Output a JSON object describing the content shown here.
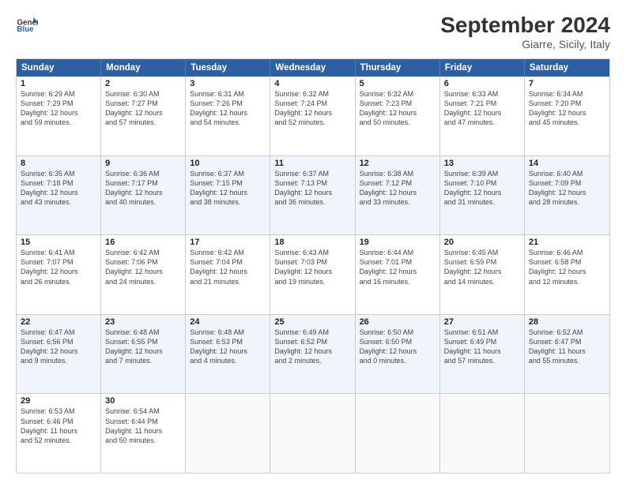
{
  "header": {
    "logo_line1": "General",
    "logo_line2": "Blue",
    "month_year": "September 2024",
    "location": "Giarre, Sicily, Italy"
  },
  "days_of_week": [
    "Sunday",
    "Monday",
    "Tuesday",
    "Wednesday",
    "Thursday",
    "Friday",
    "Saturday"
  ],
  "rows": [
    {
      "alt": false,
      "cells": [
        {
          "day": "1",
          "lines": [
            "Sunrise: 6:29 AM",
            "Sunset: 7:29 PM",
            "Daylight: 12 hours",
            "and 59 minutes."
          ]
        },
        {
          "day": "2",
          "lines": [
            "Sunrise: 6:30 AM",
            "Sunset: 7:27 PM",
            "Daylight: 12 hours",
            "and 57 minutes."
          ]
        },
        {
          "day": "3",
          "lines": [
            "Sunrise: 6:31 AM",
            "Sunset: 7:26 PM",
            "Daylight: 12 hours",
            "and 54 minutes."
          ]
        },
        {
          "day": "4",
          "lines": [
            "Sunrise: 6:32 AM",
            "Sunset: 7:24 PM",
            "Daylight: 12 hours",
            "and 52 minutes."
          ]
        },
        {
          "day": "5",
          "lines": [
            "Sunrise: 6:32 AM",
            "Sunset: 7:23 PM",
            "Daylight: 12 hours",
            "and 50 minutes."
          ]
        },
        {
          "day": "6",
          "lines": [
            "Sunrise: 6:33 AM",
            "Sunset: 7:21 PM",
            "Daylight: 12 hours",
            "and 47 minutes."
          ]
        },
        {
          "day": "7",
          "lines": [
            "Sunrise: 6:34 AM",
            "Sunset: 7:20 PM",
            "Daylight: 12 hours",
            "and 45 minutes."
          ]
        }
      ]
    },
    {
      "alt": true,
      "cells": [
        {
          "day": "8",
          "lines": [
            "Sunrise: 6:35 AM",
            "Sunset: 7:18 PM",
            "Daylight: 12 hours",
            "and 43 minutes."
          ]
        },
        {
          "day": "9",
          "lines": [
            "Sunrise: 6:36 AM",
            "Sunset: 7:17 PM",
            "Daylight: 12 hours",
            "and 40 minutes."
          ]
        },
        {
          "day": "10",
          "lines": [
            "Sunrise: 6:37 AM",
            "Sunset: 7:15 PM",
            "Daylight: 12 hours",
            "and 38 minutes."
          ]
        },
        {
          "day": "11",
          "lines": [
            "Sunrise: 6:37 AM",
            "Sunset: 7:13 PM",
            "Daylight: 12 hours",
            "and 36 minutes."
          ]
        },
        {
          "day": "12",
          "lines": [
            "Sunrise: 6:38 AM",
            "Sunset: 7:12 PM",
            "Daylight: 12 hours",
            "and 33 minutes."
          ]
        },
        {
          "day": "13",
          "lines": [
            "Sunrise: 6:39 AM",
            "Sunset: 7:10 PM",
            "Daylight: 12 hours",
            "and 31 minutes."
          ]
        },
        {
          "day": "14",
          "lines": [
            "Sunrise: 6:40 AM",
            "Sunset: 7:09 PM",
            "Daylight: 12 hours",
            "and 28 minutes."
          ]
        }
      ]
    },
    {
      "alt": false,
      "cells": [
        {
          "day": "15",
          "lines": [
            "Sunrise: 6:41 AM",
            "Sunset: 7:07 PM",
            "Daylight: 12 hours",
            "and 26 minutes."
          ]
        },
        {
          "day": "16",
          "lines": [
            "Sunrise: 6:42 AM",
            "Sunset: 7:06 PM",
            "Daylight: 12 hours",
            "and 24 minutes."
          ]
        },
        {
          "day": "17",
          "lines": [
            "Sunrise: 6:42 AM",
            "Sunset: 7:04 PM",
            "Daylight: 12 hours",
            "and 21 minutes."
          ]
        },
        {
          "day": "18",
          "lines": [
            "Sunrise: 6:43 AM",
            "Sunset: 7:03 PM",
            "Daylight: 12 hours",
            "and 19 minutes."
          ]
        },
        {
          "day": "19",
          "lines": [
            "Sunrise: 6:44 AM",
            "Sunset: 7:01 PM",
            "Daylight: 12 hours",
            "and 16 minutes."
          ]
        },
        {
          "day": "20",
          "lines": [
            "Sunrise: 6:45 AM",
            "Sunset: 6:59 PM",
            "Daylight: 12 hours",
            "and 14 minutes."
          ]
        },
        {
          "day": "21",
          "lines": [
            "Sunrise: 6:46 AM",
            "Sunset: 6:58 PM",
            "Daylight: 12 hours",
            "and 12 minutes."
          ]
        }
      ]
    },
    {
      "alt": true,
      "cells": [
        {
          "day": "22",
          "lines": [
            "Sunrise: 6:47 AM",
            "Sunset: 6:56 PM",
            "Daylight: 12 hours",
            "and 9 minutes."
          ]
        },
        {
          "day": "23",
          "lines": [
            "Sunrise: 6:48 AM",
            "Sunset: 6:55 PM",
            "Daylight: 12 hours",
            "and 7 minutes."
          ]
        },
        {
          "day": "24",
          "lines": [
            "Sunrise: 6:48 AM",
            "Sunset: 6:53 PM",
            "Daylight: 12 hours",
            "and 4 minutes."
          ]
        },
        {
          "day": "25",
          "lines": [
            "Sunrise: 6:49 AM",
            "Sunset: 6:52 PM",
            "Daylight: 12 hours",
            "and 2 minutes."
          ]
        },
        {
          "day": "26",
          "lines": [
            "Sunrise: 6:50 AM",
            "Sunset: 6:50 PM",
            "Daylight: 12 hours",
            "and 0 minutes."
          ]
        },
        {
          "day": "27",
          "lines": [
            "Sunrise: 6:51 AM",
            "Sunset: 6:49 PM",
            "Daylight: 11 hours",
            "and 57 minutes."
          ]
        },
        {
          "day": "28",
          "lines": [
            "Sunrise: 6:52 AM",
            "Sunset: 6:47 PM",
            "Daylight: 11 hours",
            "and 55 minutes."
          ]
        }
      ]
    },
    {
      "alt": false,
      "cells": [
        {
          "day": "29",
          "lines": [
            "Sunrise: 6:53 AM",
            "Sunset: 6:46 PM",
            "Daylight: 11 hours",
            "and 52 minutes."
          ]
        },
        {
          "day": "30",
          "lines": [
            "Sunrise: 6:54 AM",
            "Sunset: 6:44 PM",
            "Daylight: 11 hours",
            "and 50 minutes."
          ]
        },
        {
          "day": "",
          "lines": []
        },
        {
          "day": "",
          "lines": []
        },
        {
          "day": "",
          "lines": []
        },
        {
          "day": "",
          "lines": []
        },
        {
          "day": "",
          "lines": []
        }
      ]
    }
  ]
}
